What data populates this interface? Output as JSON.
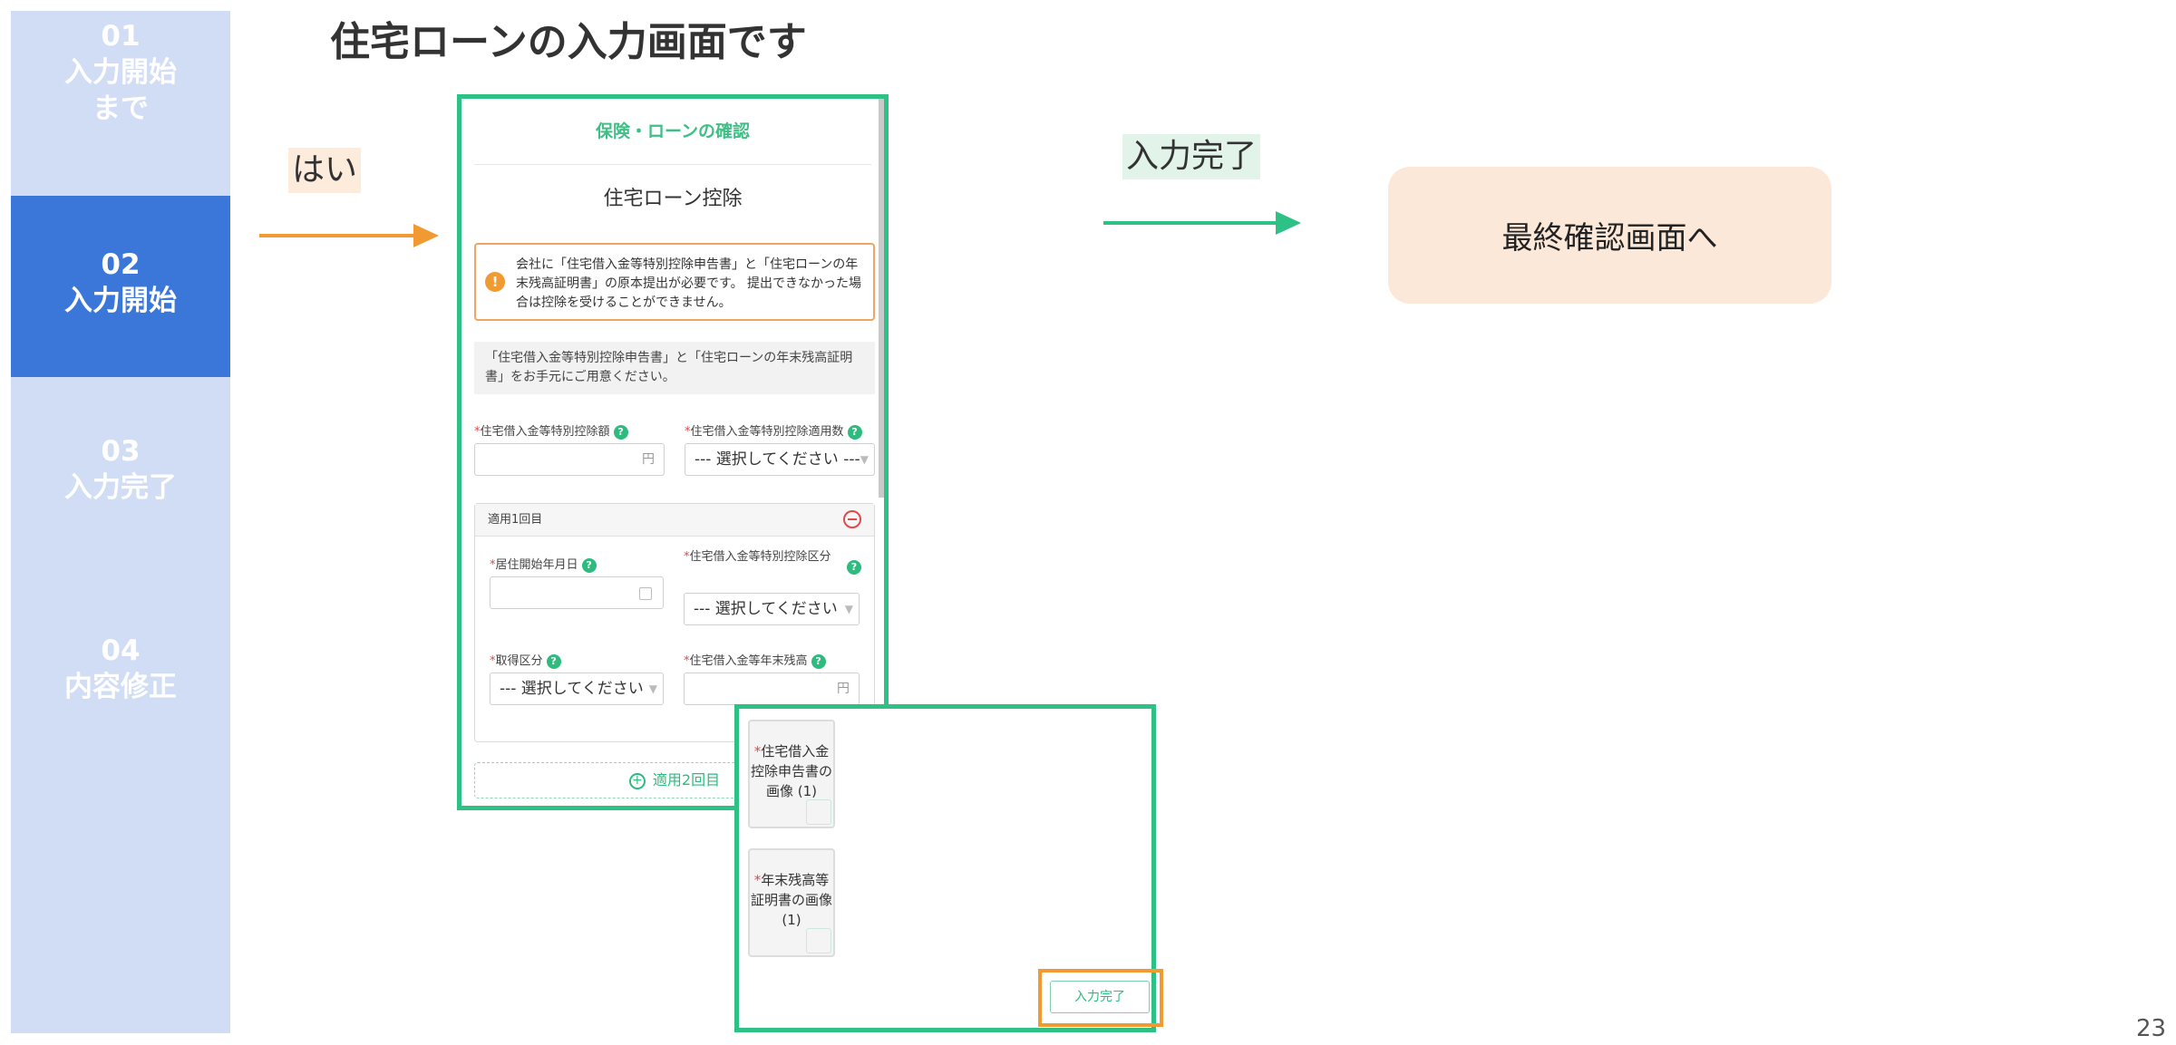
{
  "page_title": "住宅ローンの入力画面です",
  "steps": [
    {
      "num": "01",
      "label": "入力開始",
      "label2": "まで"
    },
    {
      "num": "02",
      "label": "入力開始"
    },
    {
      "num": "03",
      "label": "入力完了"
    },
    {
      "num": "04",
      "label": "内容修正"
    }
  ],
  "active_step": "02",
  "labels": {
    "yes": "はい",
    "done": "入力完了"
  },
  "final_box": "最終確認画面へ",
  "form": {
    "header": "保険・ローンの確認",
    "title": "住宅ローン控除",
    "warning_icon": "!",
    "warning": "会社に「住宅借入金等特別控除申告書」と「住宅ローンの年末残高証明書」の原本提出が必要です。 提出できなかった場合は控除を受けることができません。",
    "notice": "「住宅借入金等特別控除申告書」と「住宅ローンの年末残高証明書」をお手元にご用意ください。",
    "fields": {
      "deduction_amount": {
        "label": "住宅借入金等特別控除額",
        "unit": "円"
      },
      "apply_count": {
        "label": "住宅借入金等特別控除適用数",
        "value": "--- 選択してください ---"
      },
      "move_in_date": {
        "label": "居住開始年月日"
      },
      "deduction_type": {
        "label": "住宅借入金等特別控除区分",
        "value": "--- 選択してください"
      },
      "acquisition_type": {
        "label": "取得区分",
        "value": "--- 選択してください"
      },
      "year_end_balance": {
        "label": "住宅借入金等年末残高",
        "unit": "円"
      }
    },
    "group_title": "適用1回目",
    "add_button": "適用2回目"
  },
  "upload": {
    "items": [
      {
        "lines": [
          "住宅借入金",
          "控除申告書の",
          "画像 (1)"
        ]
      },
      {
        "lines": [
          "年末残高等",
          "証明書の画像",
          "(1)"
        ]
      }
    ],
    "done_button": "入力完了"
  },
  "page_number": "23",
  "colors": {
    "sidebar": "#d1ddf4",
    "sidebar_active": "#3b76d9",
    "green": "#2dc185",
    "orange": "#f19a32",
    "final_box": "#fbe8d9"
  },
  "icons": [
    "warning-icon",
    "help-icon",
    "calendar-icon",
    "remove-circle-icon",
    "add-circle-icon",
    "arrow-right-icon"
  ]
}
